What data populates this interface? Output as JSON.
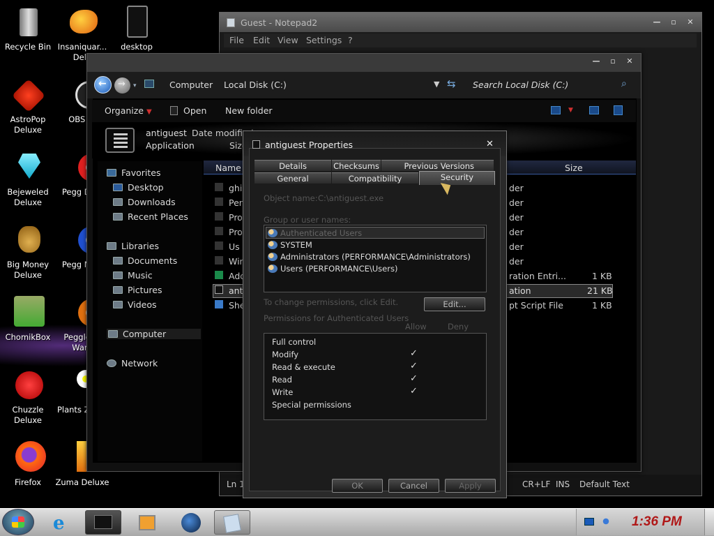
{
  "desktop_icons": [
    {
      "label": "Recycle Bin",
      "icon": "recycle-bin-icon"
    },
    {
      "label": "Insaniquar... Delu",
      "icon": "goldfish-icon"
    },
    {
      "label": "desktop",
      "icon": "text-file-icon"
    },
    {
      "label": "AstroPop Deluxe",
      "icon": "astropop-icon"
    },
    {
      "label": "OBS St",
      "icon": "obs-icon"
    },
    {
      "label": "Bejeweled Deluxe",
      "icon": "diamond-icon"
    },
    {
      "label": "Pegg Delu",
      "icon": "peggle-icon"
    },
    {
      "label": "Big Money Deluxe",
      "icon": "money-bag-icon"
    },
    {
      "label": "Pegg Nigh",
      "icon": "peggle-nights-icon"
    },
    {
      "label": "ChomikBox",
      "icon": "chomikbox-icon"
    },
    {
      "label": "Peggle of Ward",
      "icon": "peggle-wow-icon"
    },
    {
      "label": "Chuzzle Deluxe",
      "icon": "chuzzle-icon"
    },
    {
      "label": "Plants Zomb",
      "icon": "plants-zombies-icon"
    },
    {
      "label": "Firefox",
      "icon": "firefox-icon"
    },
    {
      "label": "Zuma Deluxe",
      "icon": "zuma-icon"
    }
  ],
  "notepad": {
    "title": "Guest - Notepad2",
    "menu": [
      "File",
      "Edit",
      "View",
      "Settings",
      "?"
    ],
    "status_line": "Ln 1",
    "status_crlf": "CR+LF",
    "status_ins": "INS",
    "status_scheme": "Default Text"
  },
  "explorer": {
    "breadcrumb": [
      "Computer",
      "Local Disk (C:)"
    ],
    "search_placeholder": "Search Local Disk (C:)",
    "toolbar": {
      "organize": "Organize",
      "open": "Open",
      "new_folder": "New folder"
    },
    "details": {
      "name": "antiguest",
      "type": "Application",
      "date_label": "Date modified",
      "size_label": "Size"
    },
    "columns": {
      "name": "Name",
      "size": "Size"
    },
    "nav": {
      "favorites": "Favorites",
      "favorites_items": [
        "Desktop",
        "Downloads",
        "Recent Places"
      ],
      "libraries": "Libraries",
      "libraries_items": [
        "Documents",
        "Music",
        "Pictures",
        "Videos"
      ],
      "computer": "Computer",
      "network": "Network"
    },
    "files": [
      {
        "name": "ghi",
        "type": "der",
        "size": ""
      },
      {
        "name": "Per",
        "type": "der",
        "size": ""
      },
      {
        "name": "Pro",
        "type": "der",
        "size": ""
      },
      {
        "name": "Pro",
        "type": "der",
        "size": ""
      },
      {
        "name": "Us",
        "type": "der",
        "size": ""
      },
      {
        "name": "Wir",
        "type": "der",
        "size": ""
      },
      {
        "name": "Add",
        "type": "ration Entri...",
        "size": "1 KB"
      },
      {
        "name": "anti",
        "type": "ation",
        "size": "21 KB"
      },
      {
        "name": "She",
        "type": "pt Script File",
        "size": "1 KB"
      }
    ]
  },
  "properties": {
    "title": "antiguest Properties",
    "tabs_row1": [
      "Details",
      "Checksums",
      "Previous Versions"
    ],
    "tabs_row2": [
      "General",
      "Compatibility",
      "Security"
    ],
    "object_name_label": "Object name:",
    "object_name_value": "C:\\antiguest.exe",
    "group_label": "Group or user names:",
    "users": [
      "Authenticated Users",
      "SYSTEM",
      "Administrators (PERFORMANCE\\Administrators)",
      "Users (PERFORMANCE\\Users)"
    ],
    "change_text": "To change permissions, click Edit.",
    "edit_label": "Edit...",
    "perm_label": "Permissions for Authenticated Users",
    "allow_label": "Allow",
    "deny_label": "Deny",
    "permissions": [
      {
        "name": "Full control",
        "allow": false
      },
      {
        "name": "Modify",
        "allow": true
      },
      {
        "name": "Read & execute",
        "allow": true
      },
      {
        "name": "Read",
        "allow": true
      },
      {
        "name": "Write",
        "allow": true
      },
      {
        "name": "Special permissions",
        "allow": false
      }
    ],
    "ok": "OK",
    "cancel": "Cancel",
    "apply": "Apply"
  },
  "taskbar": {
    "time": "1:36 PM",
    "check_mark": "✓"
  }
}
